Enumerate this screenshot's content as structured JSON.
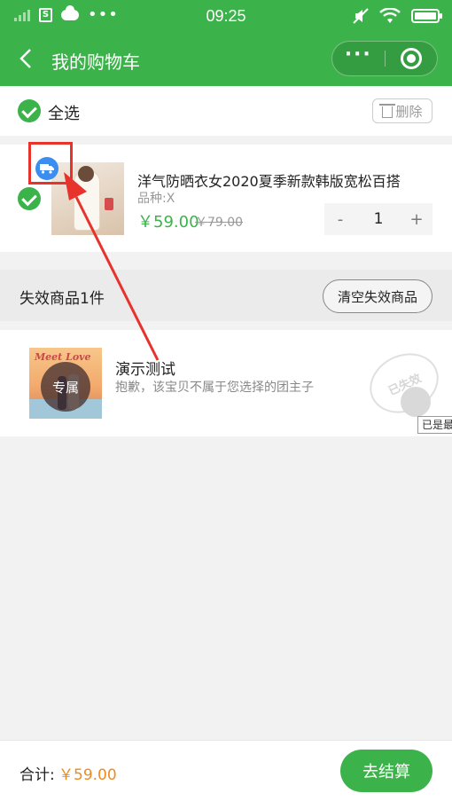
{
  "status": {
    "time": "09:25",
    "dots": "•••"
  },
  "nav": {
    "title": "我的购物车"
  },
  "select_all": {
    "label": "全选",
    "delete_label": "删除"
  },
  "cart_item": {
    "name": "洋气防晒衣女2020夏季新款韩版宽松百搭",
    "spec": "品种:X",
    "price": "￥59.00",
    "original_price": "￥79.00",
    "quantity": "1",
    "minus": "-",
    "plus": "+"
  },
  "invalid": {
    "header": "失效商品1件",
    "clear_label": "清空失效商品",
    "item": {
      "badge": "专属",
      "name": "演示测试",
      "reason": "抱歉，该宝贝不属于您选择的团主子",
      "stamp": "已失效",
      "thumb_text": "Meet Love"
    },
    "tooltip": "已是最"
  },
  "footer": {
    "total_label": "合计:",
    "total_value": "￥59.00",
    "checkout_label": "去结算"
  },
  "colors": {
    "brand_green": "#3cb34a",
    "price_orange": "#f08a1c",
    "annotation_red": "#e8332c",
    "delivery_blue": "#3b8ef0"
  },
  "icons": {
    "back": "chevron-left-icon",
    "more": "more-dots-icon",
    "close": "target-circle-icon",
    "delete": "trash-icon",
    "delivery": "truck-icon",
    "check": "check-circle-icon"
  }
}
